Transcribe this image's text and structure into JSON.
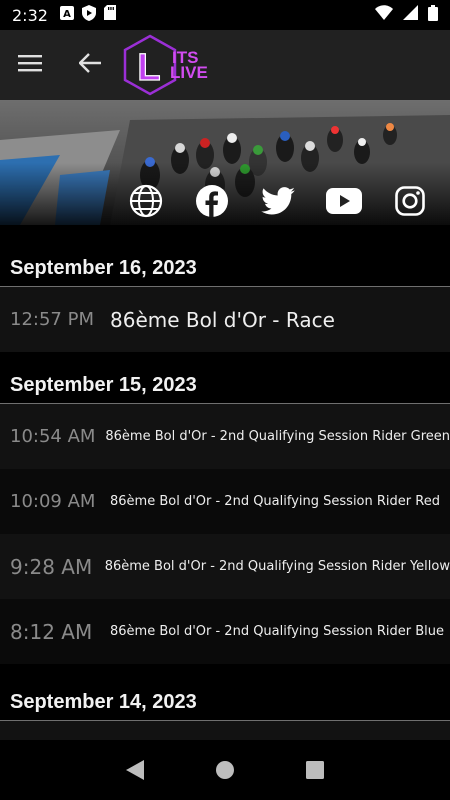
{
  "status": {
    "time": "2:32",
    "left_icons": [
      "font-a-icon",
      "shield-icon",
      "sd-card-icon"
    ],
    "right_icons": [
      "wifi-icon",
      "signal-icon",
      "battery-icon"
    ]
  },
  "appbar": {
    "logo_letter": "L",
    "logo_line1": "ITS",
    "logo_line2": "LIVE",
    "accent": "#b23be0"
  },
  "social": [
    "globe-icon",
    "facebook-icon",
    "twitter-icon",
    "youtube-icon",
    "instagram-icon"
  ],
  "sections": [
    {
      "date": "September 16, 2023",
      "items": [
        {
          "time": "12:57 PM",
          "title": "86ème Bol d'Or - Race"
        }
      ]
    },
    {
      "date": "September 15, 2023",
      "items": [
        {
          "time": "10:54 AM",
          "title": "86ème Bol d'Or - 2nd Qualifying Session Rider Green"
        },
        {
          "time": "10:09 AM",
          "title": "86ème Bol d'Or - 2nd Qualifying Session Rider Red"
        },
        {
          "time": "9:28 AM",
          "title": "86ème Bol d'Or - 2nd Qualifying Session Rider Yellow"
        },
        {
          "time": "8:12 AM",
          "title": "86ème Bol d'Or - 2nd Qualifying Session Rider Blue"
        }
      ]
    },
    {
      "date": "September 14, 2023",
      "items": []
    }
  ]
}
